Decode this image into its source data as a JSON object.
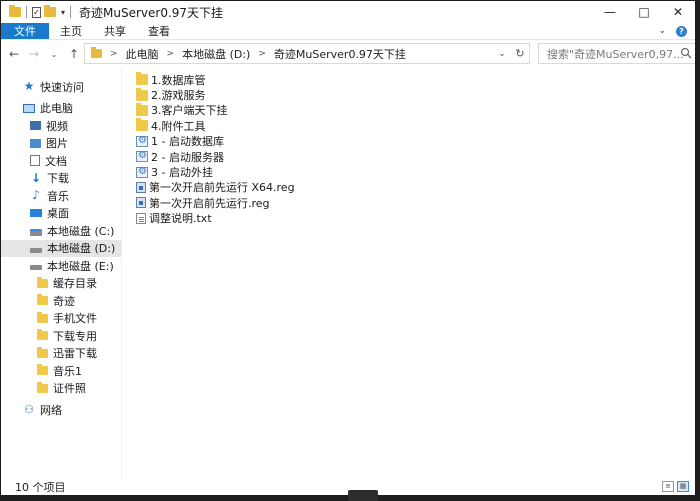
{
  "window": {
    "title": "奇迹MuServer0.97天下挂",
    "minimize_icon": "—",
    "maximize_icon": "□",
    "close_icon": "✕"
  },
  "ribbon": {
    "tabs": [
      {
        "label": "文件",
        "active": true
      },
      {
        "label": "主页"
      },
      {
        "label": "共享"
      },
      {
        "label": "查看"
      }
    ],
    "accent": "#1979ca"
  },
  "address": {
    "crumbs": [
      "此电脑",
      "本地磁盘 (D:)",
      "奇迹MuServer0.97天下挂"
    ],
    "separator": ">"
  },
  "search": {
    "placeholder": "搜索\"奇迹MuServer0,97..."
  },
  "sidebar": {
    "quick_access": "快速访问",
    "this_pc": "此电脑",
    "items": [
      {
        "label": "视频",
        "icon": "video-icon"
      },
      {
        "label": "图片",
        "icon": "picture-icon"
      },
      {
        "label": "文档",
        "icon": "document-icon"
      },
      {
        "label": "下载",
        "icon": "download-icon"
      },
      {
        "label": "音乐",
        "icon": "music-icon"
      },
      {
        "label": "桌面",
        "icon": "desktop-icon"
      }
    ],
    "drives": [
      {
        "label": "本地磁盘 (C:)",
        "icon": "drive-c-icon",
        "selected": false
      },
      {
        "label": "本地磁盘 (D:)",
        "icon": "drive-icon",
        "selected": true
      },
      {
        "label": "本地磁盘 (E:)",
        "icon": "drive-icon",
        "selected": false
      }
    ],
    "e_folders": [
      "缓存目录",
      "奇迹",
      "手机文件",
      "下载专用",
      "迅雷下载",
      "音乐1",
      "证件照"
    ],
    "network": "网络"
  },
  "files": [
    {
      "name": "1.数据库管",
      "type": "folder"
    },
    {
      "name": "2.游戏服务",
      "type": "folder"
    },
    {
      "name": "3.客户端天下挂",
      "type": "folder"
    },
    {
      "name": "4.附件工具",
      "type": "folder"
    },
    {
      "name": "1 - 启动数据库",
      "type": "batch"
    },
    {
      "name": "2 - 启动服务器",
      "type": "batch"
    },
    {
      "name": "3 - 启动外挂",
      "type": "batch"
    },
    {
      "name": "第一次开启前先运行 X64.reg",
      "type": "reg"
    },
    {
      "name": "第一次开启前先运行.reg",
      "type": "reg"
    },
    {
      "name": "调整说明.txt",
      "type": "txt"
    }
  ],
  "status": {
    "count": "10 个项目"
  }
}
